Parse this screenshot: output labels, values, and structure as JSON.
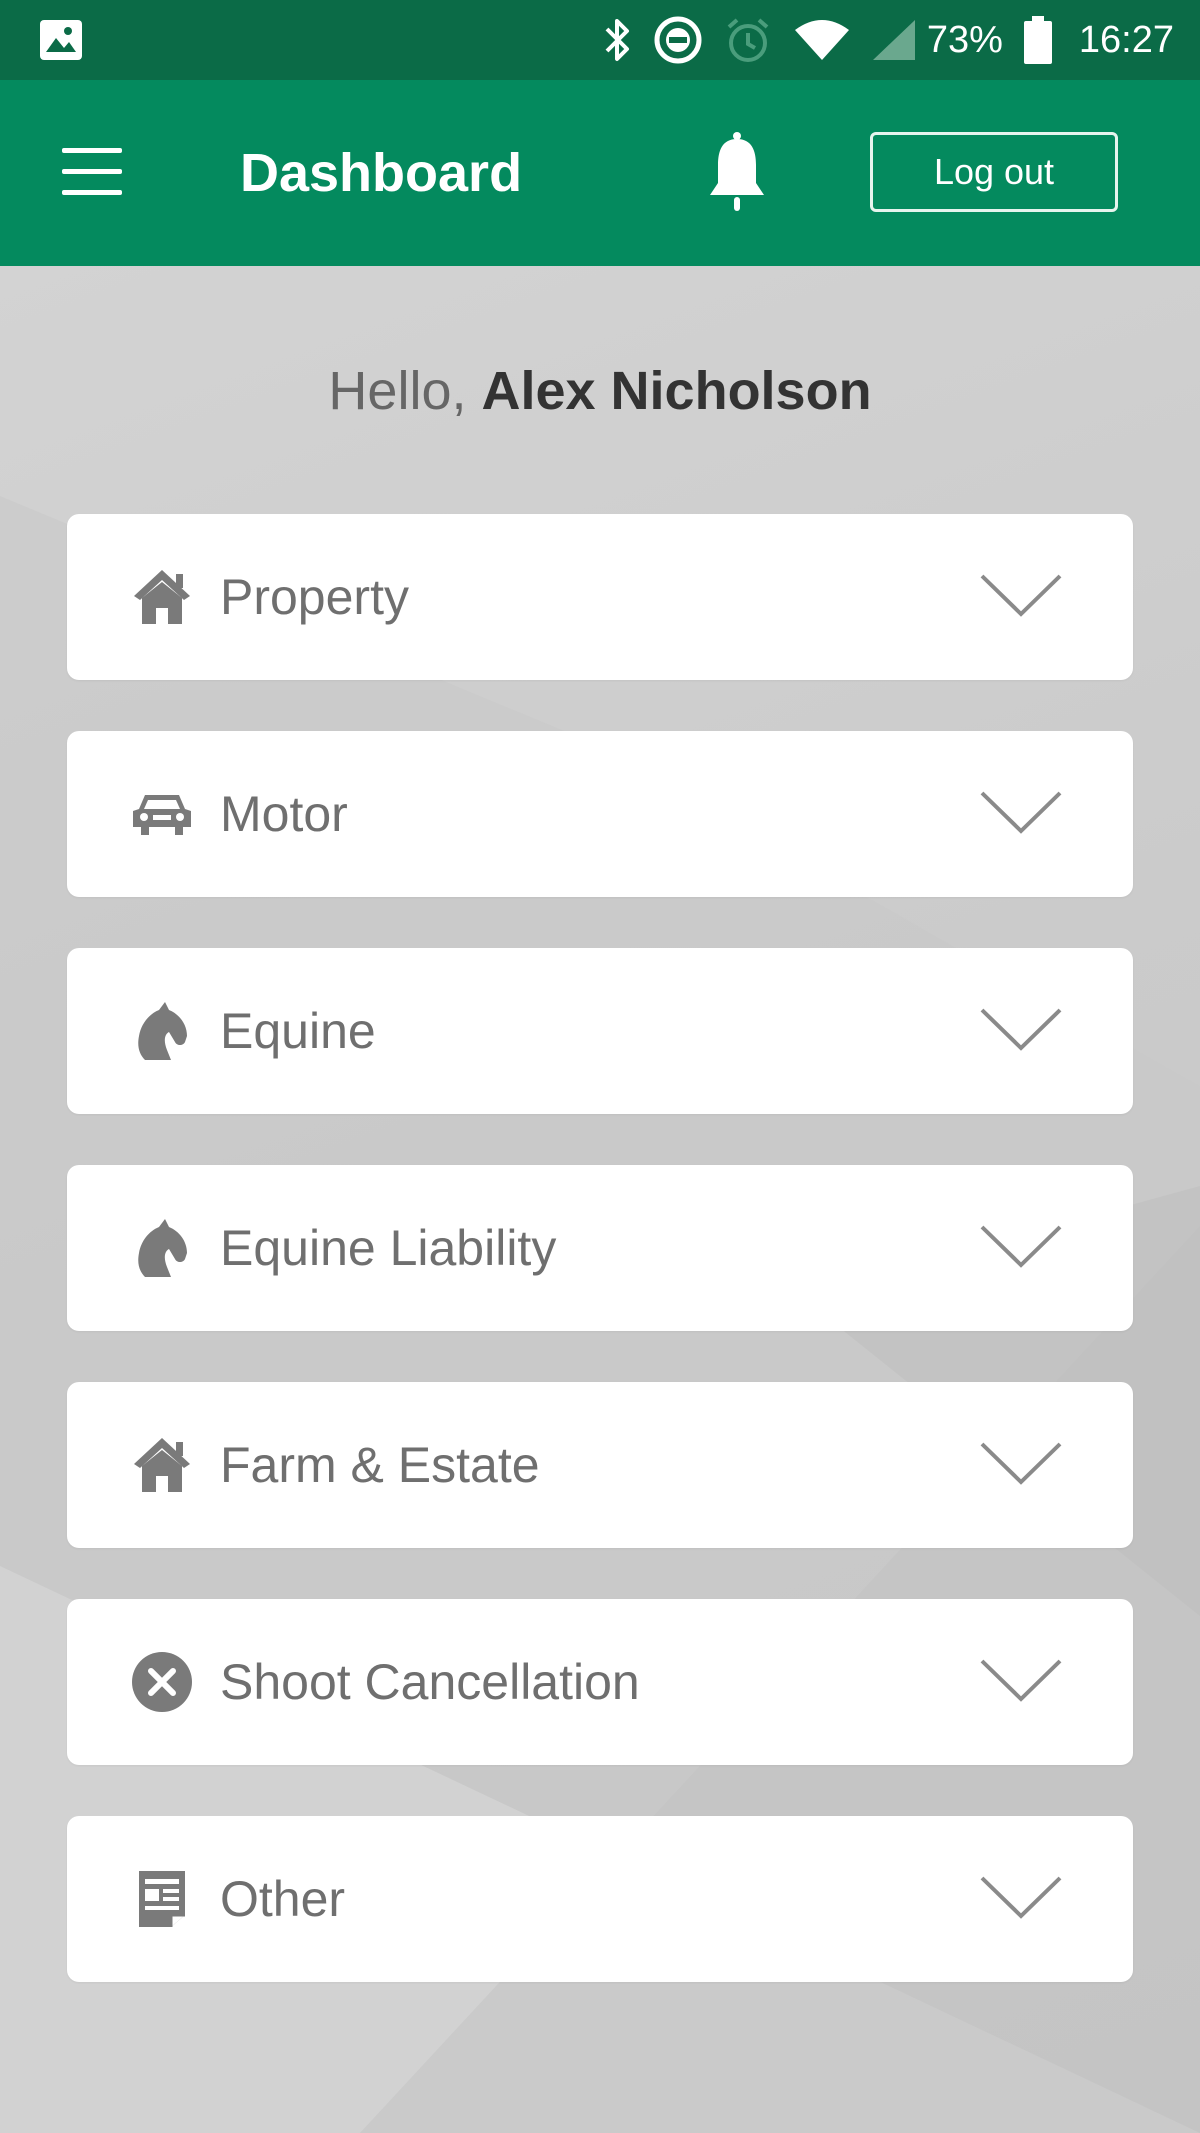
{
  "status_bar": {
    "battery": "73%",
    "time": "16:27",
    "icons": [
      "image-icon",
      "bluetooth-icon",
      "do-not-disturb-icon",
      "alarm-icon",
      "wifi-icon",
      "signal-icon",
      "battery-icon"
    ]
  },
  "app_bar": {
    "title": "Dashboard",
    "logout_label": "Log out",
    "icons": [
      "menu-icon",
      "bell-icon"
    ]
  },
  "greeting": {
    "prefix": "Hello, ",
    "name": "Alex Nicholson"
  },
  "colors": {
    "status_bar": "#0b6b47",
    "app_bar": "#048a5e",
    "card_text": "#6f6f6f",
    "icon": "#7a7a7a"
  },
  "categories": [
    {
      "label": "Property",
      "icon": "house-icon"
    },
    {
      "label": "Motor",
      "icon": "car-icon"
    },
    {
      "label": "Equine",
      "icon": "horse-head-icon"
    },
    {
      "label": "Equine Liability",
      "icon": "horse-head-icon"
    },
    {
      "label": "Farm & Estate",
      "icon": "house-icon"
    },
    {
      "label": "Shoot Cancellation",
      "icon": "cancel-circle-icon"
    },
    {
      "label": "Other",
      "icon": "document-icon"
    }
  ]
}
